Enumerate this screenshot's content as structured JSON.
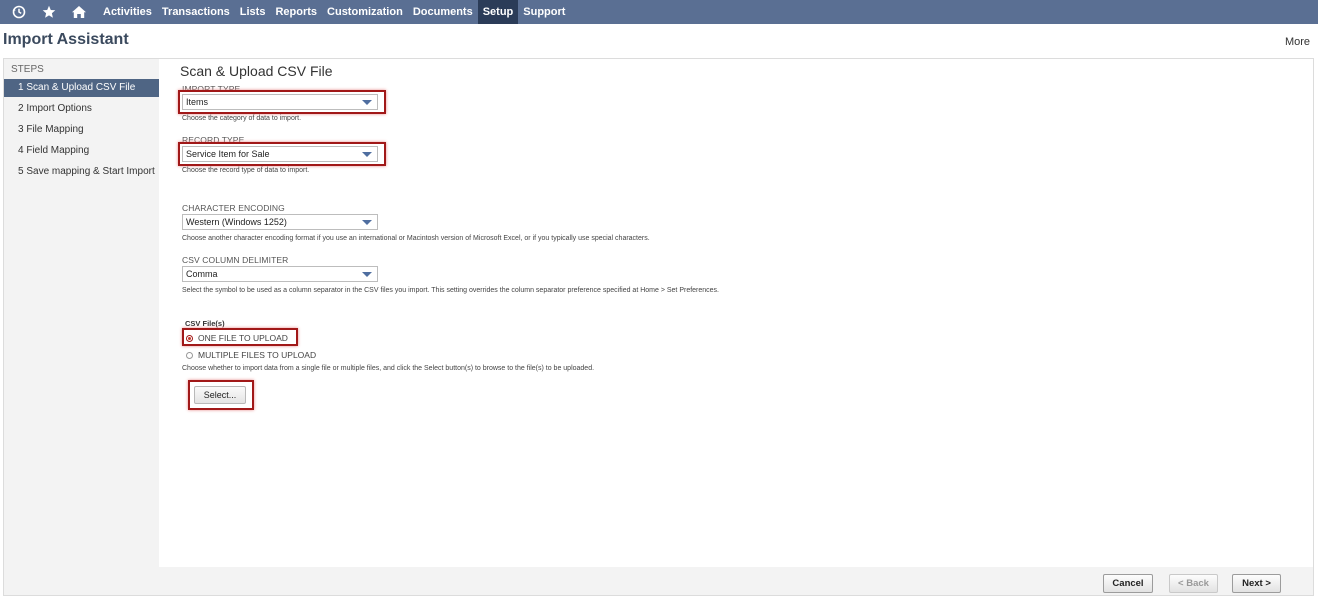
{
  "navbar": {
    "icons": [
      "recent-icon",
      "star-icon",
      "home-icon"
    ],
    "items": [
      "Activities",
      "Transactions",
      "Lists",
      "Reports",
      "Customization",
      "Documents",
      "Setup",
      "Support"
    ],
    "active": "Setup"
  },
  "page": {
    "title": "Import Assistant",
    "more_label": "More"
  },
  "sidebar": {
    "heading": "STEPS",
    "steps": [
      "1 Scan & Upload CSV File",
      "2 Import Options",
      "3 File Mapping",
      "4 Field Mapping",
      "5 Save mapping & Start Import"
    ],
    "active_index": 0
  },
  "main": {
    "section_title": "Scan & Upload CSV File",
    "import_type": {
      "label": "IMPORT TYPE",
      "value": "Items",
      "help": "Choose the category of data to import."
    },
    "record_type": {
      "label": "RECORD TYPE",
      "value": "Service Item for Sale",
      "help": "Choose the record type of data to import."
    },
    "character_encoding": {
      "label": "CHARACTER ENCODING",
      "value": "Western (Windows 1252)",
      "help": "Choose another character encoding format if you use an international or Macintosh version of Microsoft Excel, or if you typically use special characters."
    },
    "csv_delimiter": {
      "label": "CSV COLUMN DELIMITER",
      "value": "Comma",
      "help": "Select the symbol to be used as a column separator in the CSV files you import. This setting overrides the column separator preference specified at Home > Set Preferences."
    },
    "csv_files": {
      "label": "CSV File(s)",
      "option_one": "ONE FILE TO UPLOAD",
      "option_multiple": "MULTIPLE FILES TO UPLOAD",
      "selected": "ONE FILE TO UPLOAD",
      "help": "Choose whether to import data from a single file or multiple files, and click the Select button(s) to browse to the file(s) to be uploaded.",
      "select_button": "Select..."
    }
  },
  "footer": {
    "cancel": "Cancel",
    "back": "< Back",
    "next": "Next >"
  },
  "colors": {
    "navbar": "#5a6f93",
    "active_nav": "#2b3c58",
    "active_step": "#4f6584",
    "highlight": "#a11818"
  }
}
